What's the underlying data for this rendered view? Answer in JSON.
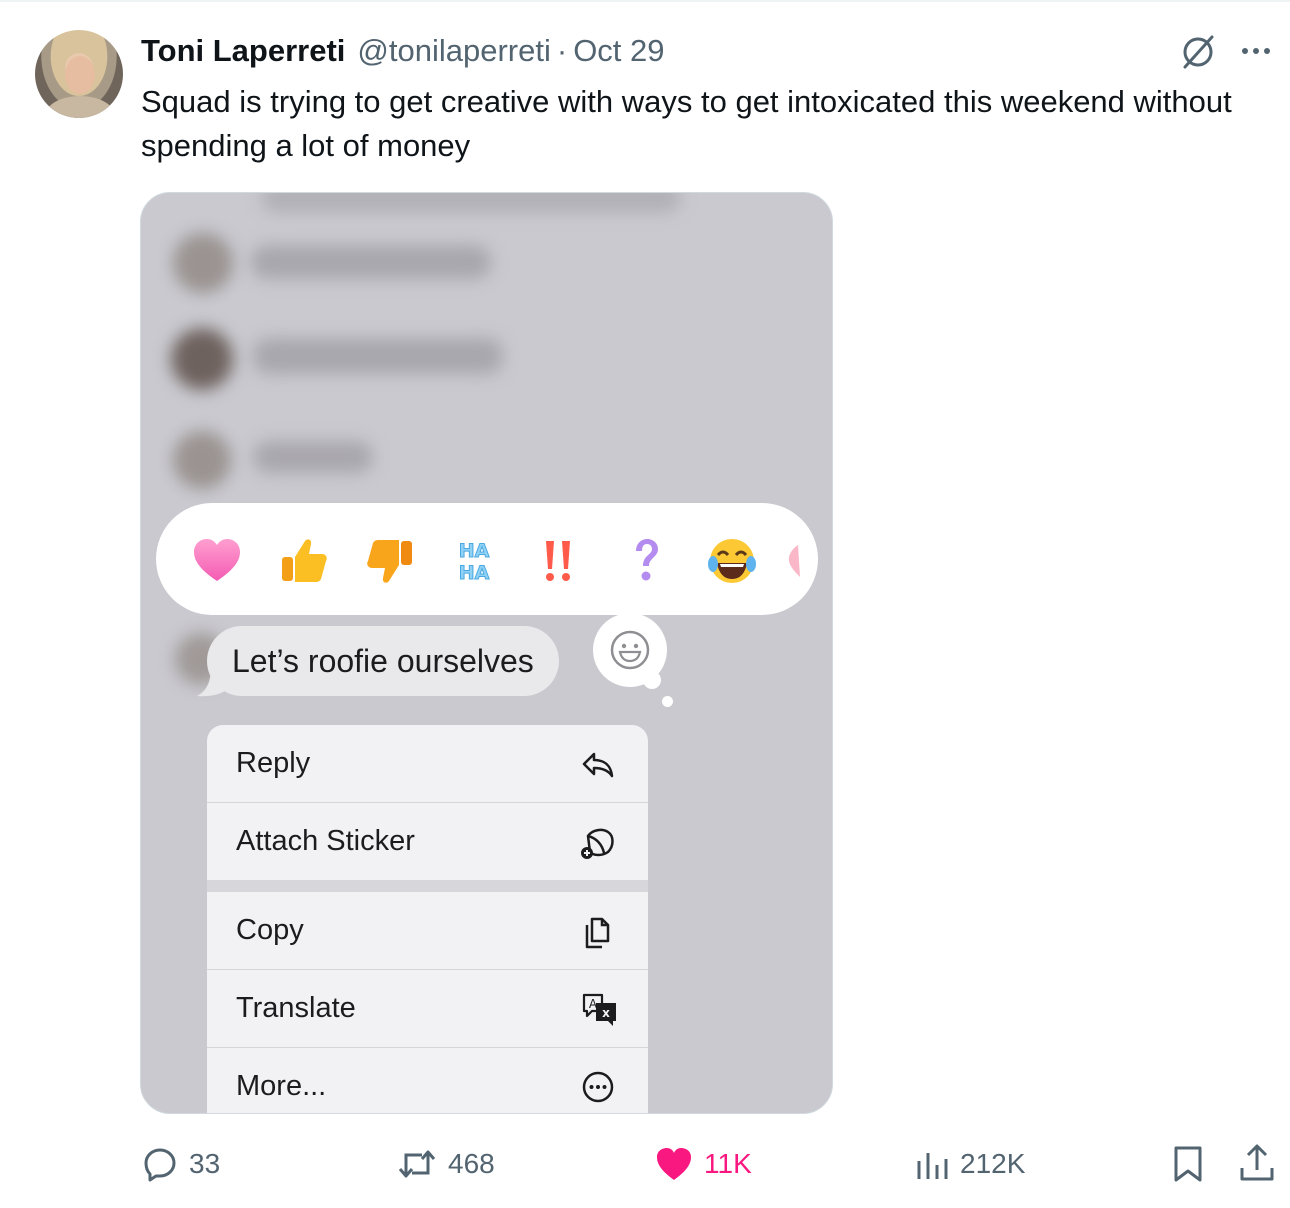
{
  "tweet": {
    "author_name": "Toni Laperreti",
    "handle": "@tonilaperreti",
    "separator": "·",
    "date": "Oct 29",
    "text": "Squad is trying to get creative with ways to get intoxicated this weekend without spending a lot of money"
  },
  "media": {
    "message_text": "Let’s roofie ourselves",
    "reactions": [
      "heart",
      "thumbs-up",
      "thumbs-down",
      "haha",
      "exclamation",
      "question",
      "laughing-face",
      "heart-partial"
    ],
    "menu": [
      {
        "label": "Reply",
        "icon": "reply-icon"
      },
      {
        "label": "Attach Sticker",
        "icon": "sticker-icon"
      },
      {
        "label": "Copy",
        "icon": "copy-icon"
      },
      {
        "label": "Translate",
        "icon": "translate-icon"
      },
      {
        "label": "More...",
        "icon": "more-circle-icon"
      }
    ]
  },
  "actions": {
    "replies": "33",
    "reposts": "468",
    "likes": "11K",
    "views": "212K"
  },
  "colors": {
    "text": "#0f1419",
    "muted": "#536471",
    "like_active": "#f91880"
  }
}
